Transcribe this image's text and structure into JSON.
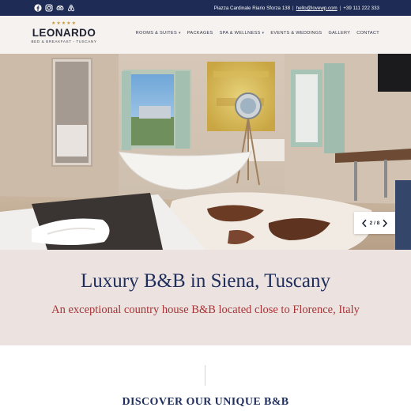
{
  "topbar": {
    "background": "#1d2b55",
    "social_icons": [
      "facebook-icon",
      "instagram-icon",
      "tripadvisor-icon",
      "airbnb-icon"
    ],
    "address": "Piazza Cardinale Riario Sforza 138",
    "separator_1": "|",
    "email": "hello@lovewp.com",
    "separator_2": "|",
    "phone": "+39 111 222 333"
  },
  "header": {
    "logo": {
      "stars": "★★★★★",
      "name": "LEONARDO",
      "tagline": "BED & BREAKFAST  -  TUSCANY"
    },
    "nav": [
      {
        "label": "ROOMS & SUITES",
        "has_dropdown": true
      },
      {
        "label": "PACKAGES",
        "has_dropdown": false
      },
      {
        "label": "SPA & WELLNESS",
        "has_dropdown": true
      },
      {
        "label": "EVENTS & WEDDINGS",
        "has_dropdown": false
      },
      {
        "label": "GALLERY",
        "has_dropdown": false
      },
      {
        "label": "CONTACT",
        "has_dropdown": false
      }
    ]
  },
  "hero": {
    "slider_counter": "2 / 8",
    "prev_icon": "chevron-left-icon",
    "next_icon": "chevron-right-icon"
  },
  "intro": {
    "title": "Luxury B&B in Siena, Tuscany",
    "subtitle": "An exceptional country house B&B located close to Florence, Italy",
    "title_color": "#1e2d5c",
    "subtitle_color": "#a63437",
    "background": "#ece3e0"
  },
  "discover": {
    "heading": "DISCOVER OUR UNIQUE B&B"
  }
}
